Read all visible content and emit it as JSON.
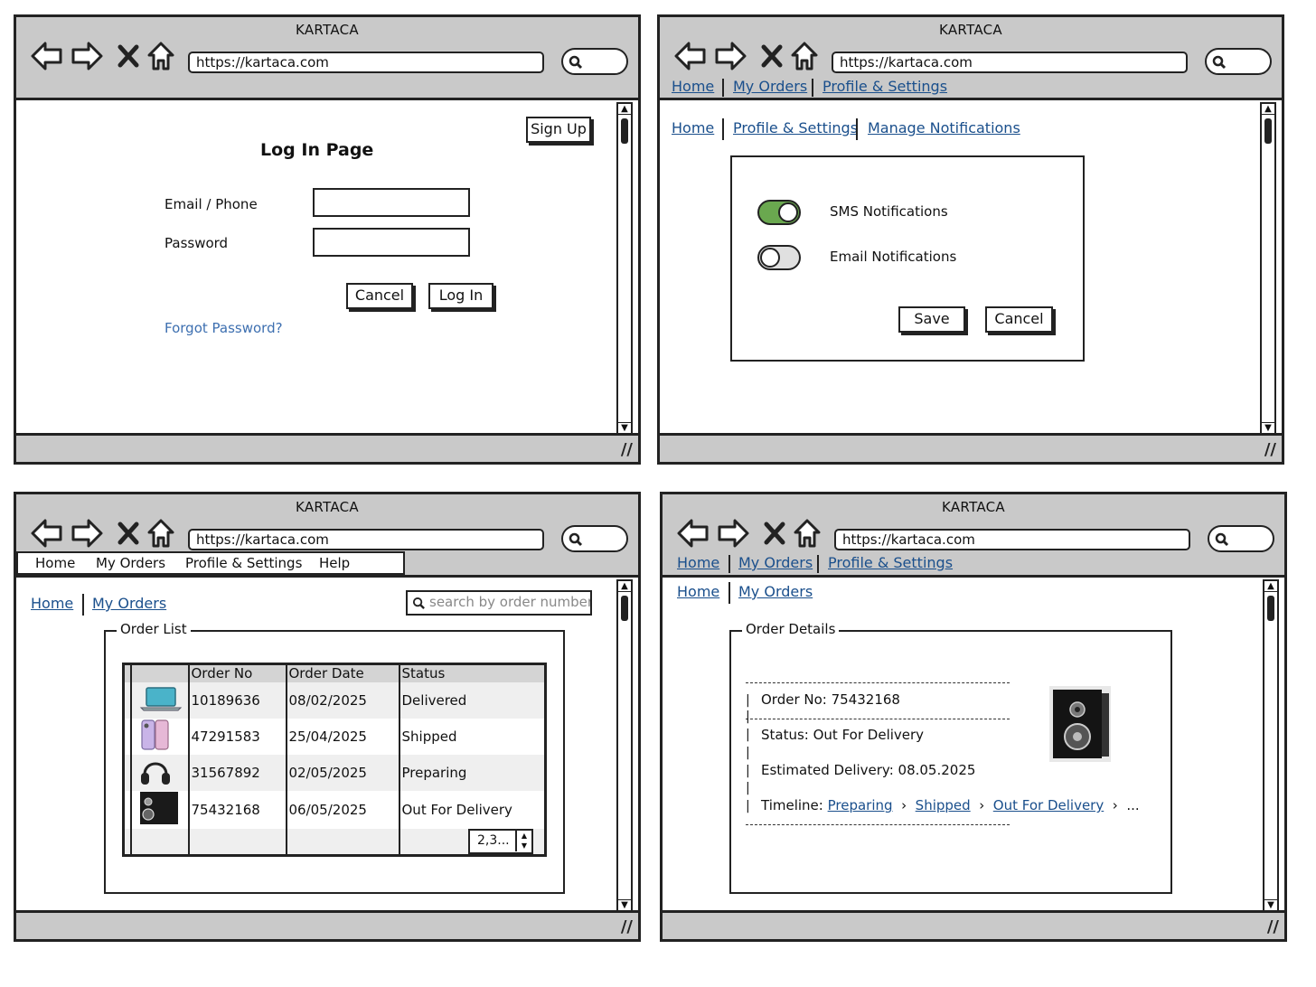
{
  "app_title": "KARTACA",
  "url": "https://kartaca.com",
  "windows": {
    "login": {
      "signup_label": "Sign Up",
      "page_title": "Log In Page",
      "email_label": "Email / Phone",
      "password_label": "Password",
      "cancel_label": "Cancel",
      "login_label": "Log In",
      "forgot_label": "Forgot Password?"
    },
    "notifications": {
      "nav": [
        "Home",
        "My Orders",
        "Profile & Settings"
      ],
      "breadcrumb": [
        "Home",
        "Profile & Settings",
        "Manage Notifications"
      ],
      "sms_label": "SMS Notifications",
      "sms_on": true,
      "email_label": "Email Notifications",
      "email_on": false,
      "save_label": "Save",
      "cancel_label": "Cancel",
      "colors": {
        "toggle_on": "#6aa84f",
        "toggle_off": "#e0e0e0"
      }
    },
    "orders": {
      "menu": [
        "Home",
        "My Orders",
        "Profile & Settings",
        "Help"
      ],
      "breadcrumb": [
        "Home",
        "My Orders"
      ],
      "search_placeholder": "search by order number",
      "legend": "Order List",
      "columns": [
        "Order No",
        "Order Date",
        "Status"
      ],
      "rows": [
        {
          "icon": "laptop-icon",
          "order_no": "10189636",
          "date": "08/02/2025",
          "status": "Delivered"
        },
        {
          "icon": "phone-icon",
          "order_no": "47291583",
          "date": "25/04/2025",
          "status": "Shipped"
        },
        {
          "icon": "headphones-icon",
          "order_no": "31567892",
          "date": "02/05/2025",
          "status": "Preparing"
        },
        {
          "icon": "speaker-icon",
          "order_no": "75432168",
          "date": "06/05/2025",
          "status": "Out For Delivery"
        }
      ],
      "pager_value": "2,3..."
    },
    "details": {
      "nav": [
        "Home",
        "My Orders",
        "Profile & Settings"
      ],
      "breadcrumb": [
        "Home",
        "My Orders"
      ],
      "legend": "Order Details",
      "order_no": "Order No: 75432168",
      "status": "Status: Out For Delivery",
      "estimated": "Estimated Delivery: 08.05.2025",
      "timeline_label": "Timeline:",
      "timeline": [
        "Preparing",
        "Shipped",
        "Out For Delivery"
      ],
      "timeline_more": "..."
    }
  }
}
